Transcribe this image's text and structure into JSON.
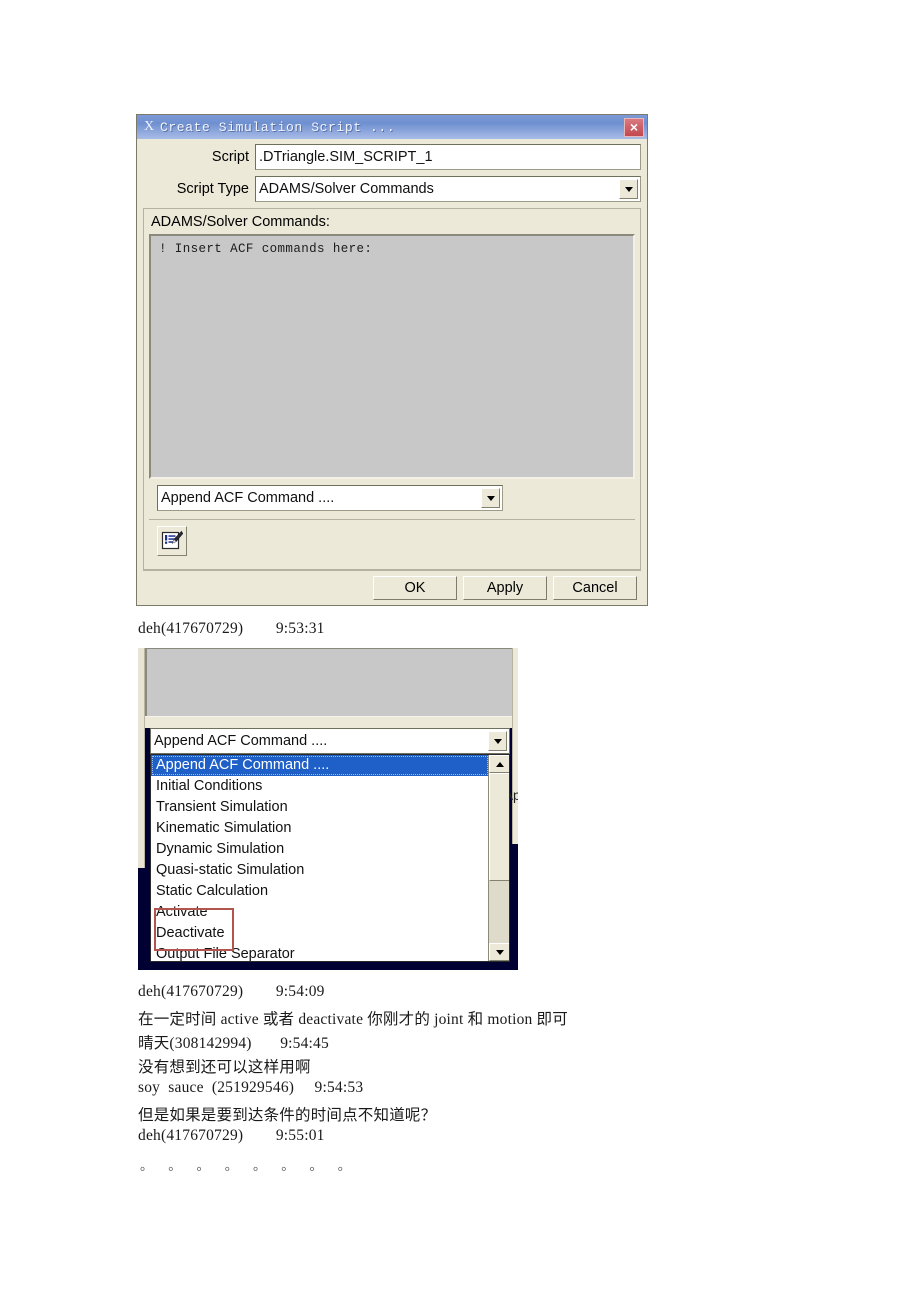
{
  "dialog": {
    "title": "Create Simulation Script ...",
    "sysicon": "X",
    "close_label": "×",
    "script_label": "Script",
    "script_value": ".DTriangle.SIM_SCRIPT_1",
    "script_type_label": "Script Type",
    "script_type_value": "ADAMS/Solver Commands",
    "commands_group_label": "ADAMS/Solver Commands:",
    "commands_text": "!  Insert ACF commands here:",
    "append_combo_value": "Append ACF Command ....",
    "buttons": {
      "ok": "OK",
      "apply": "Apply",
      "cancel": "Cancel"
    }
  },
  "dropdown_shot": {
    "combo_value": "Append ACF Command ....",
    "items": [
      "Append ACF Command ....",
      "Initial Conditions",
      "Transient Simulation",
      "Kinematic Simulation",
      "Dynamic Simulation",
      "Quasi-static Simulation",
      "Static Calculation",
      "Activate",
      "Deactivate",
      "Output File Separator"
    ],
    "selected_index": 0,
    "highlight_items": [
      "Activate",
      "Deactivate"
    ],
    "highlight_color": "#b4544f",
    "selection_color": "#1e5fc8",
    "ghost_button_text": "Ap"
  },
  "chat": {
    "entry1_head": "deh(417670729)        9:53:31",
    "entry2_head": "deh(417670729)        9:54:09",
    "entry2_msg": "在一定时间 active 或者 deactivate 你刚才的 joint 和 motion 即可",
    "entry3_head": "晴天(308142994)       9:54:45",
    "entry3_msg": "没有想到还可以这样用啊",
    "entry4_head": "soy  sauce  (251929546)     9:54:53",
    "entry4_msg": "但是如果是要到达条件的时间点不知道呢？",
    "entry5_head": "deh(417670729)        9:55:01",
    "dots": "。 。 。 。 。 。 。 。"
  },
  "colors": {
    "dialog_bg": "#ece9d8",
    "titlebar_blue": "#7b9ad6",
    "textarea_grey": "#c8c8c8",
    "close_red": "#c1484f"
  }
}
